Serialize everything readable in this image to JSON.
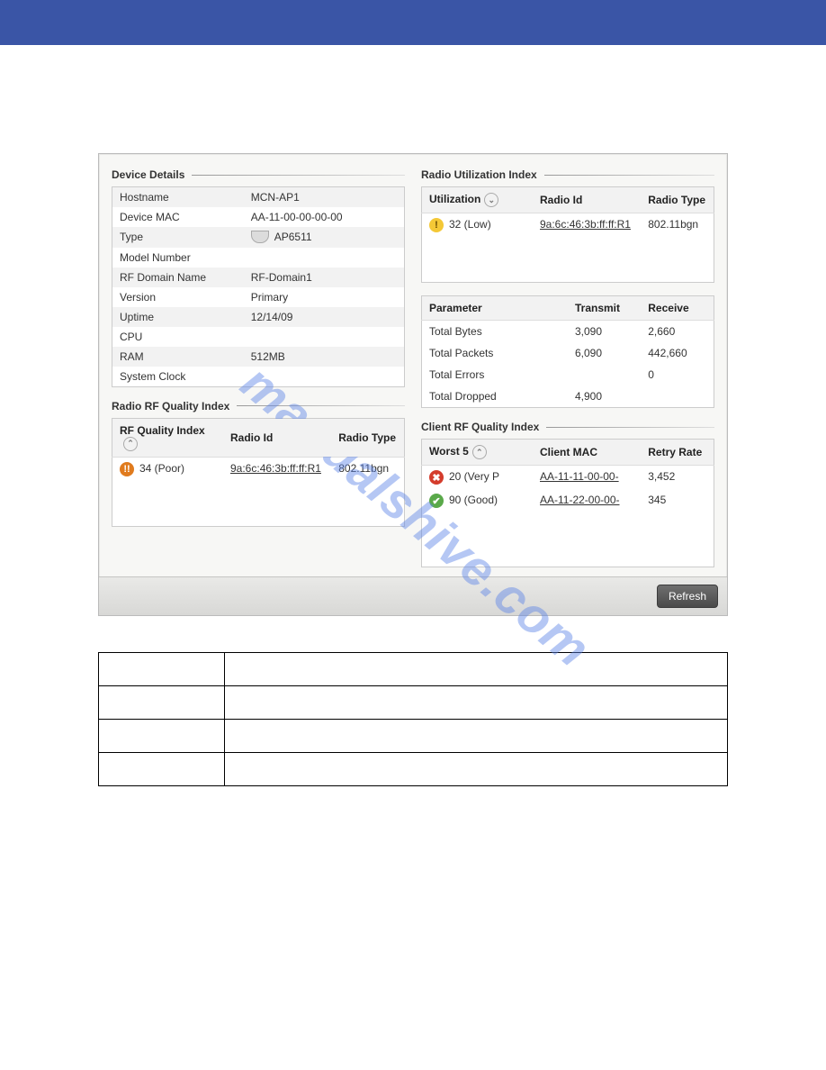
{
  "watermark": "manualshive.com",
  "deviceDetails": {
    "title": "Device Details",
    "rows": {
      "hostname_k": "Hostname",
      "hostname_v": "MCN-AP1",
      "mac_k": "Device MAC",
      "mac_v": "AA-11-00-00-00-00",
      "type_k": "Type",
      "type_v": "AP6511",
      "model_k": "Model Number",
      "model_v": "",
      "rfdom_k": "RF Domain Name",
      "rfdom_v": "RF-Domain1",
      "ver_k": "Version",
      "ver_v": "Primary",
      "up_k": "Uptime",
      "up_v": "12/14/09",
      "cpu_k": "CPU",
      "cpu_v": "",
      "ram_k": "RAM",
      "ram_v": "512MB",
      "clock_k": "System Clock",
      "clock_v": ""
    }
  },
  "radioRF": {
    "title": "Radio RF Quality Index",
    "headers": {
      "c1": "RF Quality Index",
      "c2": "Radio Id",
      "c3": "Radio Type"
    },
    "row": {
      "icon_glyph": "!!",
      "quality": "34 (Poor)",
      "radio_id": "9a:6c:46:3b:ff:ff:R1",
      "radio_type": "802.11bgn"
    }
  },
  "radioUtil": {
    "title": "Radio Utilization Index",
    "headers": {
      "c1": "Utilization",
      "c2": "Radio Id",
      "c3": "Radio Type"
    },
    "row": {
      "icon_glyph": "!",
      "util": "32 (Low)",
      "radio_id": "9a:6c:46:3b:ff:ff:R1",
      "radio_type": "802.11bgn"
    }
  },
  "params": {
    "headers": {
      "c1": "Parameter",
      "c2": "Transmit",
      "c3": "Receive"
    },
    "rows": [
      {
        "p": "Total Bytes",
        "t": "3,090",
        "r": "2,660"
      },
      {
        "p": "Total Packets",
        "t": "6,090",
        "r": "442,660"
      },
      {
        "p": "Total Errors",
        "t": "",
        "r": "0"
      },
      {
        "p": "Total Dropped",
        "t": "4,900",
        "r": ""
      }
    ]
  },
  "clientRF": {
    "title": "Client RF Quality Index",
    "headers": {
      "c1": "Worst 5",
      "c2": "Client MAC",
      "c3": "Retry Rate"
    },
    "rows": [
      {
        "icon": "bad",
        "icon_glyph": "✖",
        "q": "20 (Very P",
        "mac": "AA-11-11-00-00-",
        "retry": "3,452"
      },
      {
        "icon": "good",
        "icon_glyph": "✔",
        "q": "90 (Good)",
        "mac": "AA-11-22-00-00-",
        "retry": "345"
      }
    ]
  },
  "refresh_label": "Refresh"
}
